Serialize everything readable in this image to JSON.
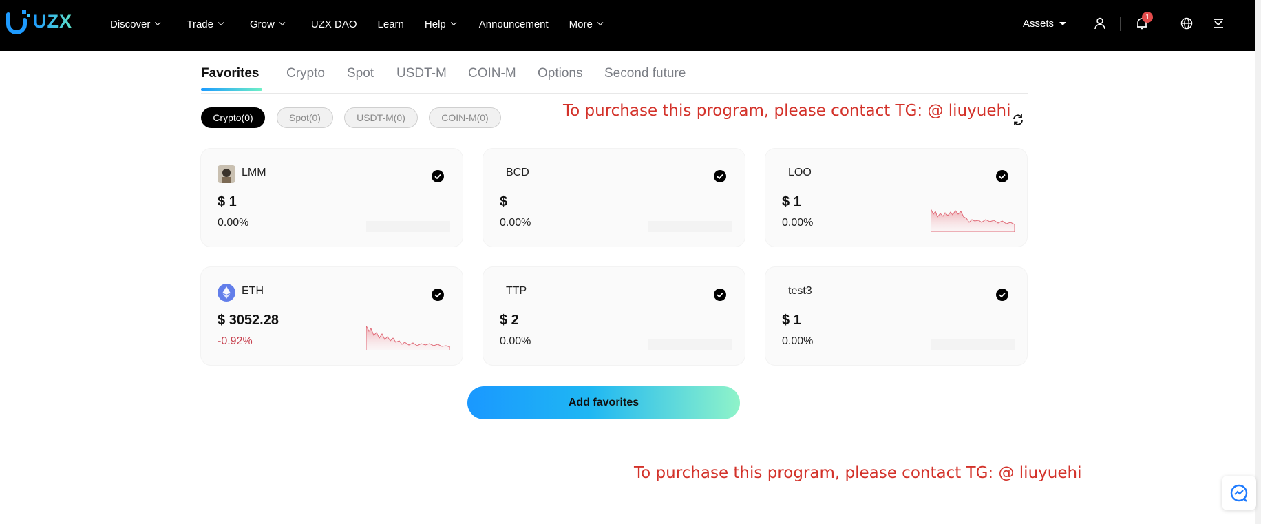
{
  "brand": {
    "logo_text": "UZX"
  },
  "nav": {
    "items": [
      {
        "label": "Discover",
        "dropdown": true
      },
      {
        "label": "Trade",
        "dropdown": true
      },
      {
        "label": "Grow",
        "dropdown": true
      },
      {
        "label": "UZX DAO",
        "dropdown": false
      },
      {
        "label": "Learn",
        "dropdown": false
      },
      {
        "label": "Help",
        "dropdown": true
      },
      {
        "label": "Announcement",
        "dropdown": false
      },
      {
        "label": "More",
        "dropdown": true
      }
    ]
  },
  "header_right": {
    "assets_label": "Assets",
    "notification_count": "1",
    "icons": [
      "user-icon",
      "bell-icon",
      "globe-icon",
      "download-icon"
    ]
  },
  "tabs": [
    {
      "label": "Favorites",
      "active": true
    },
    {
      "label": "Crypto"
    },
    {
      "label": "Spot"
    },
    {
      "label": "USDT-M"
    },
    {
      "label": "COIN-M"
    },
    {
      "label": "Options"
    },
    {
      "label": "Second future"
    }
  ],
  "filters": [
    {
      "label": "Crypto(0)",
      "active": true
    },
    {
      "label": "Spot(0)"
    },
    {
      "label": "USDT-M(0)"
    },
    {
      "label": "COIN-M(0)"
    }
  ],
  "promo_text": "To purchase this program, please contact TG: @ liuyuehi",
  "cards": [
    {
      "symbol": "LMM",
      "price": "$ 1",
      "change": "0.00%",
      "trend": "flat",
      "icon": "avatar-image"
    },
    {
      "symbol": "BCD",
      "price": "$",
      "change": "0.00%",
      "trend": "flat",
      "icon": "none"
    },
    {
      "symbol": "LOO",
      "price": "$ 1",
      "change": "0.00%",
      "trend": "down",
      "icon": "none"
    },
    {
      "symbol": "ETH",
      "price": "$ 3052.28",
      "change": "-0.92%",
      "trend": "down",
      "icon": "ethereum-icon"
    },
    {
      "symbol": "TTP",
      "price": "$ 2",
      "change": "0.00%",
      "trend": "flat",
      "icon": "none"
    },
    {
      "symbol": "test3",
      "price": "$ 1",
      "change": "0.00%",
      "trend": "flat",
      "icon": "none"
    }
  ],
  "add_button_label": "Add favorites",
  "colors": {
    "header_bg": "#000000",
    "accent_gradient_start": "#1a98ff",
    "accent_gradient_end": "#8ff3c9",
    "negative": "#c7414f",
    "promo": "#d3322a"
  }
}
